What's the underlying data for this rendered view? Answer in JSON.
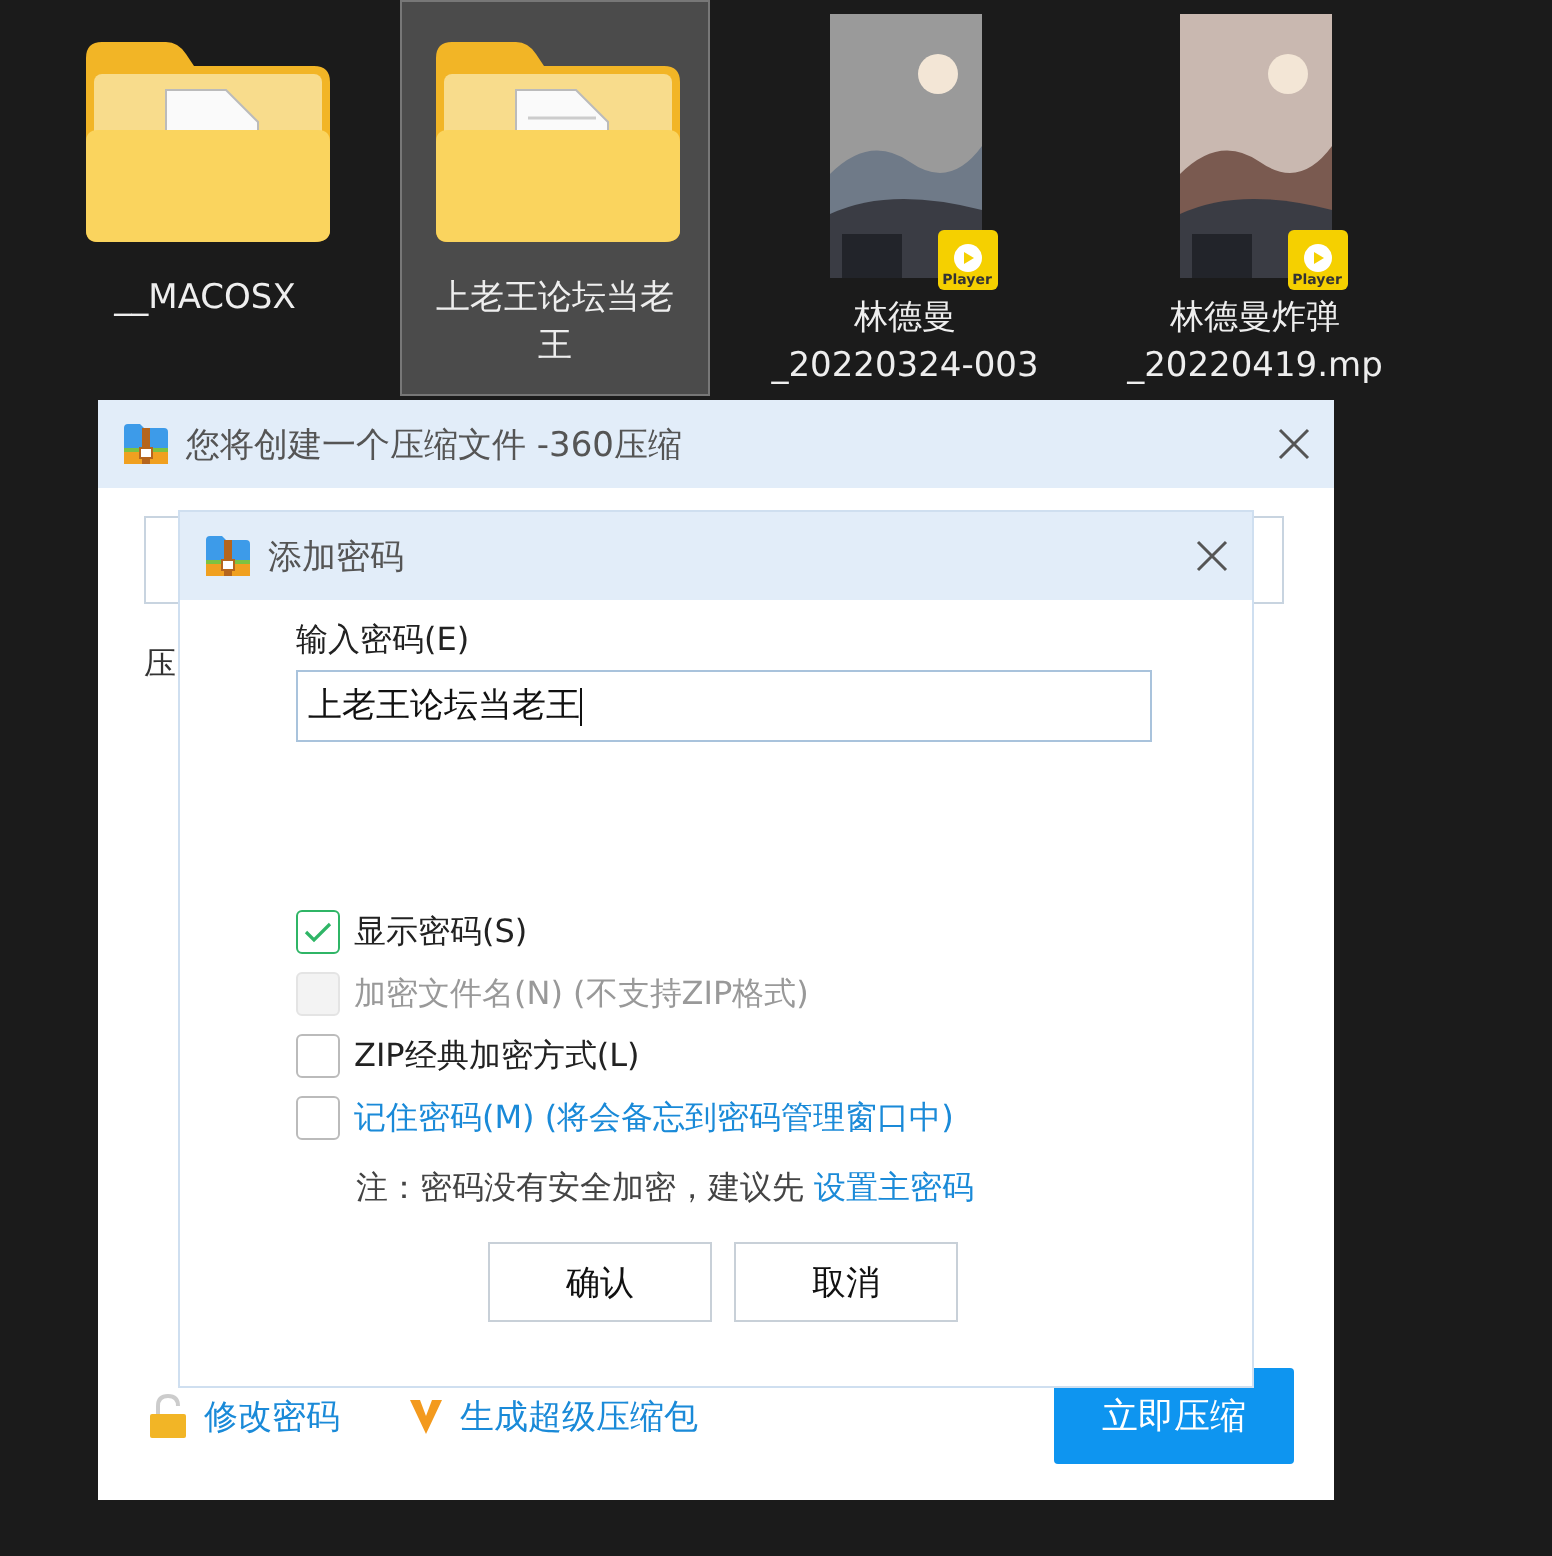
{
  "files": [
    {
      "kind": "folder",
      "label_lines": [
        "__MACOSX"
      ],
      "selected": false
    },
    {
      "kind": "folder",
      "label_lines": [
        "上老王论坛当老",
        "王"
      ],
      "selected": true
    },
    {
      "kind": "video",
      "label_lines": [
        "林德曼",
        "_20220324-003"
      ],
      "badge": "Player",
      "selected": false
    },
    {
      "kind": "video",
      "label_lines": [
        "林德曼炸弹",
        "_20220419.mp"
      ],
      "badge": "Player",
      "selected": false
    }
  ],
  "back_dialog": {
    "title": "您将创建一个压缩文件 -360压缩",
    "label": "压",
    "change_password": "修改密码",
    "super_pack": "生成超级压缩包",
    "compress_button": "立即压缩"
  },
  "password_dialog": {
    "title": "添加密码",
    "password_label": "输入密码(E)",
    "password_value": "上老王论坛当老王",
    "options": [
      {
        "kind": "plain",
        "label": "显示密码(S)",
        "checked": true,
        "disabled": false
      },
      {
        "kind": "plain",
        "label": "加密文件名(N) (不支持ZIP格式)",
        "checked": false,
        "disabled": true
      },
      {
        "kind": "plain",
        "label": "ZIP经典加密方式(L)",
        "checked": false,
        "disabled": false
      },
      {
        "kind": "link",
        "label": "记住密码(M) (将会备忘到密码管理窗口中)",
        "checked": false,
        "disabled": false
      }
    ],
    "note": "注：密码没有安全加密，建议先",
    "note_link": "设置主密码",
    "buttons": [
      "确认",
      "取消"
    ]
  }
}
